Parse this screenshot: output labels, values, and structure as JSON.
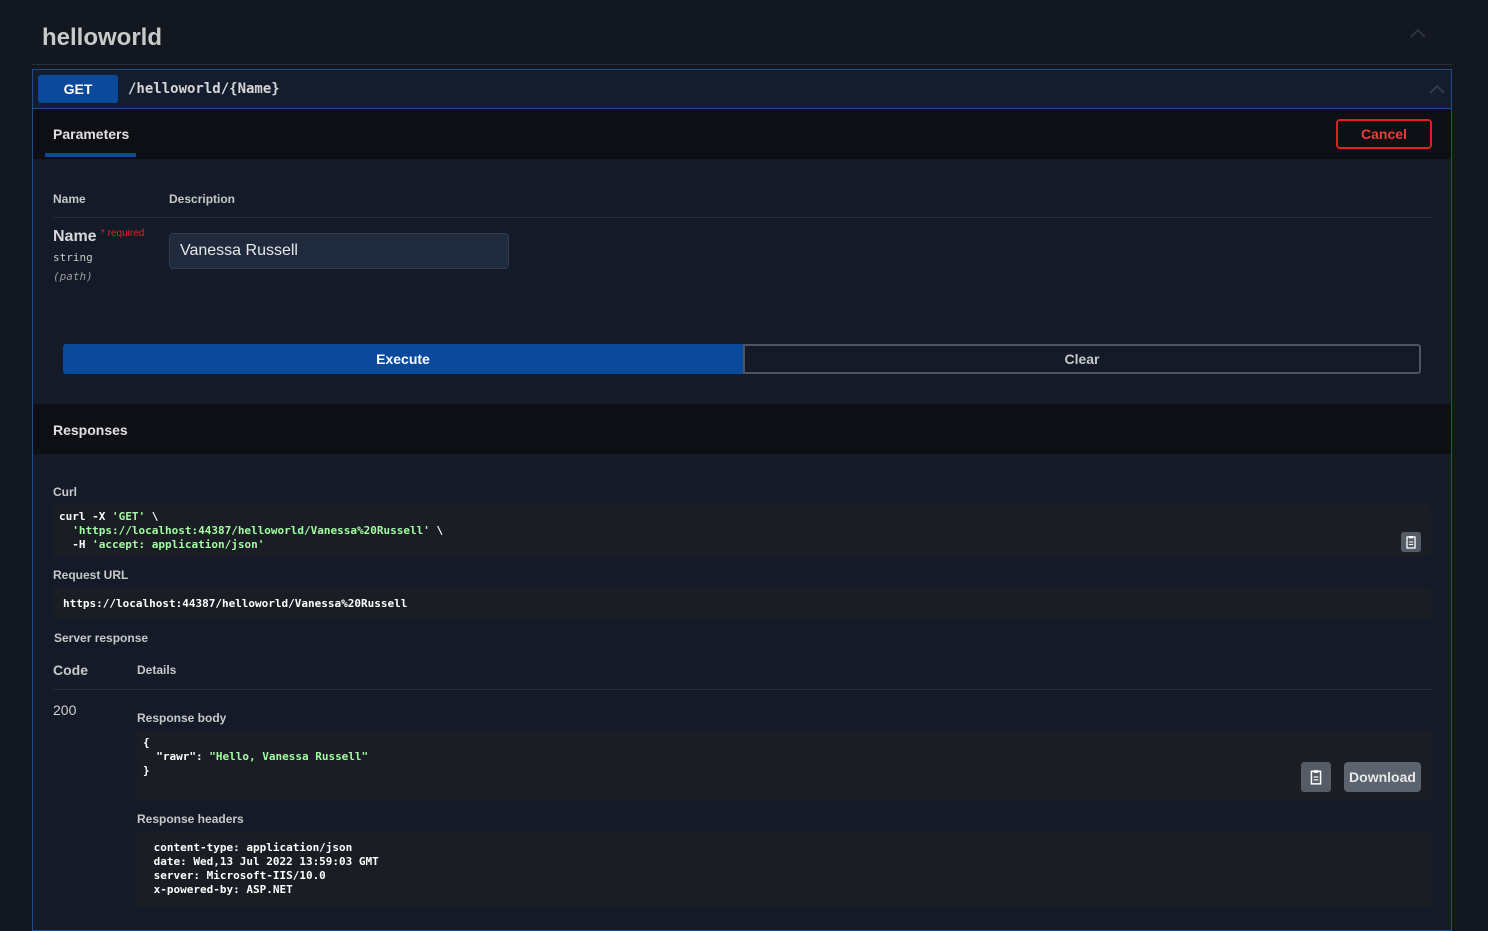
{
  "tag": {
    "title": "helloworld"
  },
  "operation": {
    "method": "GET",
    "path": "/helloworld/{Name}"
  },
  "tabs": {
    "parameters": "Parameters",
    "cancel": "Cancel"
  },
  "params": {
    "col_name": "Name",
    "col_description": "Description",
    "items": [
      {
        "name": "Name",
        "required": "* required",
        "type": "string",
        "in": "(path)",
        "value": "Vanessa Russell"
      }
    ]
  },
  "actions": {
    "execute": "Execute",
    "clear": "Clear"
  },
  "responses": {
    "title": "Responses",
    "curl_label": "Curl",
    "curl": {
      "l1_pre": "curl -X ",
      "l1_str": "'GET'",
      "l1_post": " \\",
      "l2_pre": "  ",
      "l2_str": "'https://localhost:44387/helloworld/Vanessa%20Russell'",
      "l2_post": " \\",
      "l3_pre": "  -H ",
      "l3_str": "'accept: application/json'"
    },
    "request_url_label": "Request URL",
    "request_url": "https://localhost:44387/helloworld/Vanessa%20Russell",
    "server_response_label": "Server response",
    "col_code": "Code",
    "col_details": "Details",
    "code": "200",
    "body_label": "Response body",
    "body": {
      "l1": "{",
      "l2_pre": "  \"rawr\": ",
      "l2_str": "\"Hello, Vanessa Russell\"",
      "l3": "}"
    },
    "download": "Download",
    "headers_label": "Response headers",
    "headers": [
      " content-type: application/json ",
      " date: Wed,13 Jul 2022 13:59:03 GMT ",
      " server: Microsoft-IIS/10.0 ",
      " x-powered-by: ASP.NET "
    ]
  },
  "colors": {
    "accent": "#0b4a9a",
    "danger": "#e02020",
    "string": "#a2fca2",
    "background": "#131720"
  },
  "icons": {
    "collapse": "chevron-up-icon",
    "copy": "clipboard-icon"
  }
}
